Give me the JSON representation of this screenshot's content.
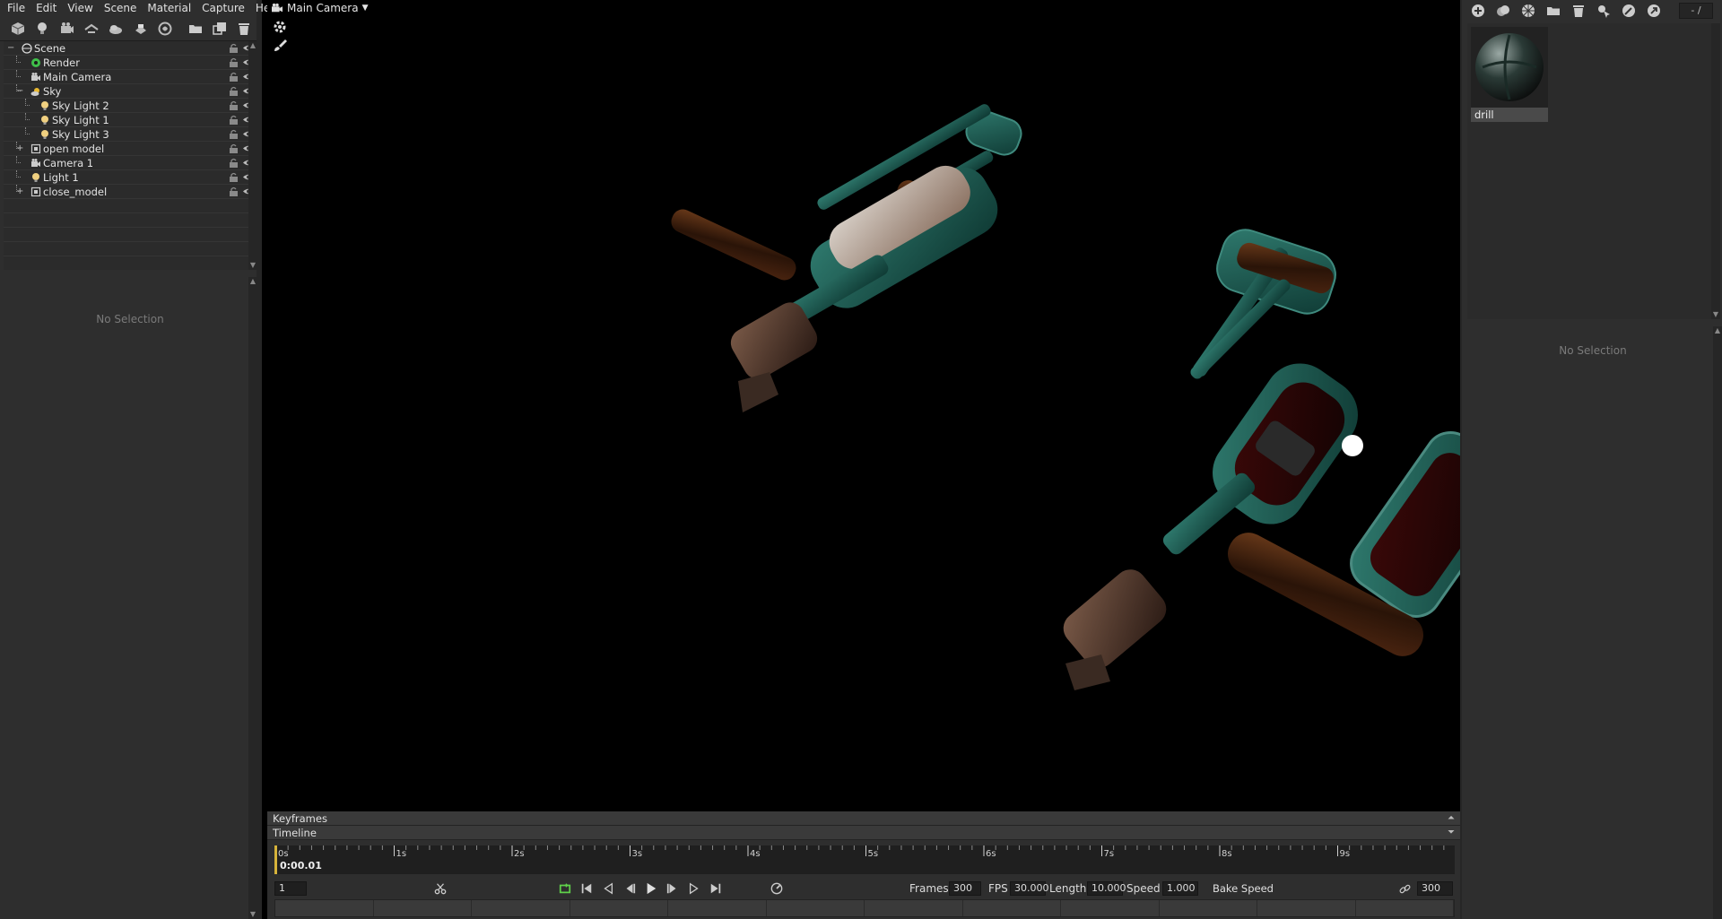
{
  "menu": [
    "File",
    "Edit",
    "View",
    "Scene",
    "Material",
    "Capture",
    "Help"
  ],
  "left_toolbar": {
    "icons": [
      "add-object-icon",
      "add-light-icon",
      "add-camera-icon",
      "add-fog-icon",
      "add-sky-icon",
      "add-shadow-catcher-icon",
      "add-audio-icon",
      "import-folder-icon",
      "duplicate-icon",
      "delete-icon"
    ]
  },
  "scene_tree": {
    "items": [
      {
        "label": "Scene",
        "level": 0,
        "icon": "scene-icon",
        "expander": "−"
      },
      {
        "label": "Render",
        "level": 1,
        "icon": "render-icon"
      },
      {
        "label": "Main Camera",
        "level": 1,
        "icon": "camera-icon"
      },
      {
        "label": "Sky",
        "level": 1,
        "icon": "sky-icon",
        "expander": "−"
      },
      {
        "label": "Sky Light 2",
        "level": 2,
        "icon": "light-bulb-icon"
      },
      {
        "label": "Sky Light 1",
        "level": 2,
        "icon": "light-bulb-icon"
      },
      {
        "label": "Sky Light 3",
        "level": 2,
        "icon": "light-bulb-icon"
      },
      {
        "label": "open model",
        "level": 1,
        "icon": "model-icon",
        "expander": "+"
      },
      {
        "label": "Camera 1",
        "level": 1,
        "icon": "camera-icon"
      },
      {
        "label": "Light 1",
        "level": 1,
        "icon": "light-bulb-icon"
      },
      {
        "label": "close_model",
        "level": 1,
        "icon": "model-icon",
        "expander": "+"
      }
    ]
  },
  "left_properties": {
    "empty_text": "No Selection"
  },
  "viewport": {
    "camera_name": "Main Camera"
  },
  "keyframes": {
    "title": "Keyframes"
  },
  "timeline": {
    "title": "Timeline",
    "ticks": [
      "0s",
      "1s",
      "2s",
      "3s",
      "4s",
      "5s",
      "6s",
      "7s",
      "8s",
      "9s"
    ],
    "current_time": "0:00.01",
    "current_frame": "1",
    "frames_label": "Frames",
    "frames_value": "300",
    "fps_label": "FPS",
    "fps_value": "30.000",
    "length_label": "Length",
    "length_value": "10.000",
    "speed_label": "Speed",
    "speed_value": "1.000",
    "bake_label": "Bake Speed",
    "end_frame": "300"
  },
  "right_toolbar": {
    "icons": [
      "new-material-icon",
      "duplicate-material-icon",
      "checker-icon",
      "folder-icon",
      "delete-icon",
      "select-icon",
      "pick-icon",
      "share-icon"
    ],
    "page": "- /"
  },
  "materials": [
    {
      "name": "drill"
    }
  ],
  "right_properties": {
    "empty_text": "No Selection"
  },
  "colors": {
    "accent_green": "#5fd04a",
    "teal_metal": "#1f5a52",
    "panel_bg": "#2e2e2e"
  }
}
